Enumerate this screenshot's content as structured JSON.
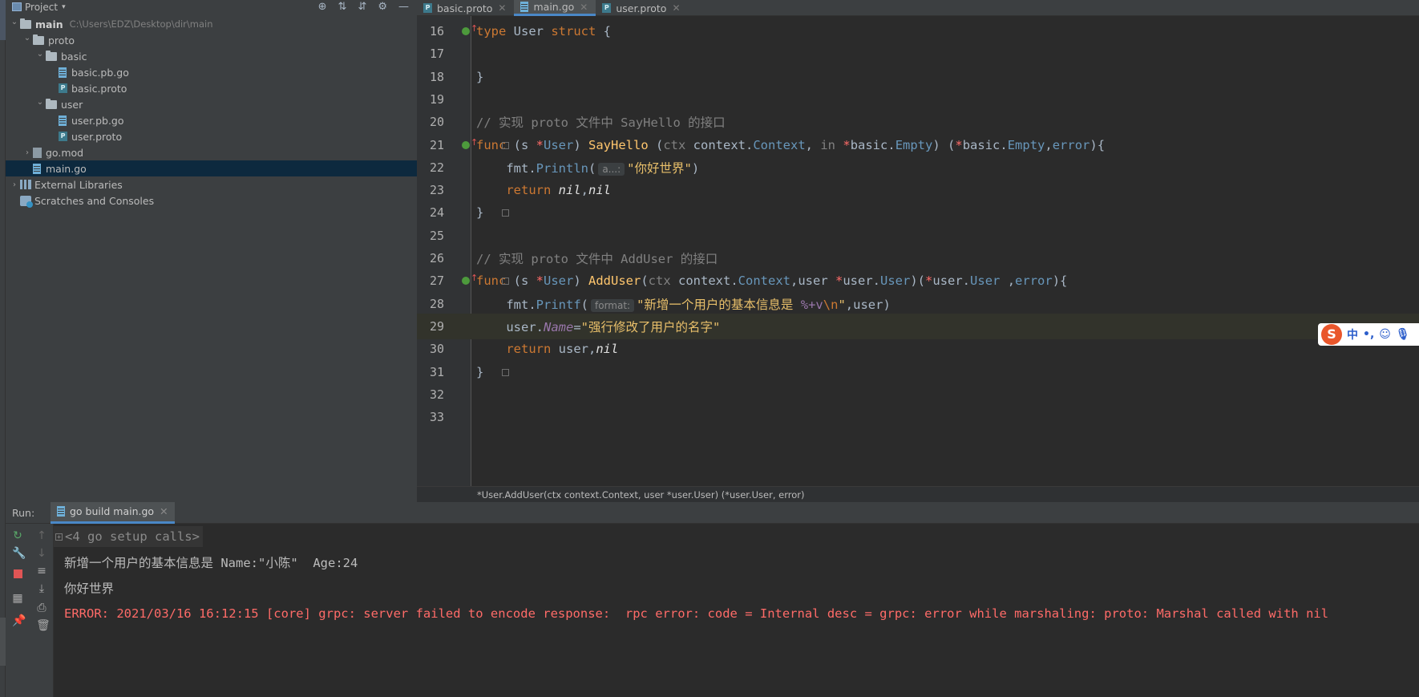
{
  "project": {
    "title": "Project",
    "root": {
      "name": "main",
      "path": "C:\\Users\\EDZ\\Desktop\\dir\\main"
    },
    "tree": [
      {
        "label": "main",
        "depth": 0,
        "kind": "folder",
        "expanded": true
      },
      {
        "label": "proto",
        "depth": 1,
        "kind": "folder",
        "expanded": true
      },
      {
        "label": "basic",
        "depth": 2,
        "kind": "folder",
        "expanded": true
      },
      {
        "label": "basic.pb.go",
        "depth": 3,
        "kind": "go"
      },
      {
        "label": "basic.proto",
        "depth": 3,
        "kind": "proto"
      },
      {
        "label": "user",
        "depth": 2,
        "kind": "folder",
        "expanded": true
      },
      {
        "label": "user.pb.go",
        "depth": 3,
        "kind": "go"
      },
      {
        "label": "user.proto",
        "depth": 3,
        "kind": "proto"
      },
      {
        "label": "go.mod",
        "depth": 1,
        "kind": "mod",
        "expanded": false
      },
      {
        "label": "main.go",
        "depth": 1,
        "kind": "go",
        "selected": true
      },
      {
        "label": "External Libraries",
        "depth": 0,
        "kind": "lib",
        "expanded": false
      },
      {
        "label": "Scratches and Consoles",
        "depth": 0,
        "kind": "scratch"
      }
    ]
  },
  "tabs": [
    {
      "label": "basic.proto",
      "icon": "proto-file-icon",
      "active": false
    },
    {
      "label": "main.go",
      "icon": "go-file-icon",
      "active": true
    },
    {
      "label": "user.proto",
      "icon": "proto-file-icon",
      "active": false
    }
  ],
  "editor": {
    "lines": [
      "16",
      "17",
      "18",
      "19",
      "20",
      "21",
      "22",
      "23",
      "24",
      "25",
      "26",
      "27",
      "28",
      "29",
      "30",
      "31",
      "32",
      "33"
    ],
    "hints": {
      "println": "a...:",
      "printf": "format:"
    },
    "comments": {
      "sayhello": "// 实现 proto 文件中 SayHello 的接口",
      "adduser": "// 实现 proto 文件中 AddUser 的接口"
    },
    "strings": {
      "hello": "\"你好世界\"",
      "printf_a": "\"新增一个用户的基本信息是 ",
      "printf_fmt": "%+v",
      "printf_esc": "\\n",
      "printf_b": "\"",
      "name": "\"强行修改了用户的名字\""
    }
  },
  "breadcrumb": "*User.AddUser(ctx context.Context, user *user.User) (*user.User, error)",
  "run": {
    "label": "Run:",
    "tab": "go build main.go",
    "output": [
      {
        "text": "<4 go setup calls>",
        "kind": "group"
      },
      {
        "text": "新增一个用户的基本信息是 Name:\"小陈\"  Age:24",
        "kind": "normal"
      },
      {
        "text": "你好世界",
        "kind": "normal"
      },
      {
        "text": "ERROR: 2021/03/16 16:12:15 [core] grpc: server failed to encode response:  rpc error: code = Internal desc = grpc: error while marshaling: proto: Marshal called with nil",
        "kind": "error"
      }
    ]
  },
  "ime": {
    "lang": "中",
    "punct": "•,",
    "icons": [
      "emoji-icon",
      "mic-icon"
    ]
  },
  "colors": {
    "keyword": "#cc7832",
    "function": "#ffc66d",
    "string": "#e8bf6a",
    "error": "#ff6b68",
    "selection": "#0d293e"
  }
}
